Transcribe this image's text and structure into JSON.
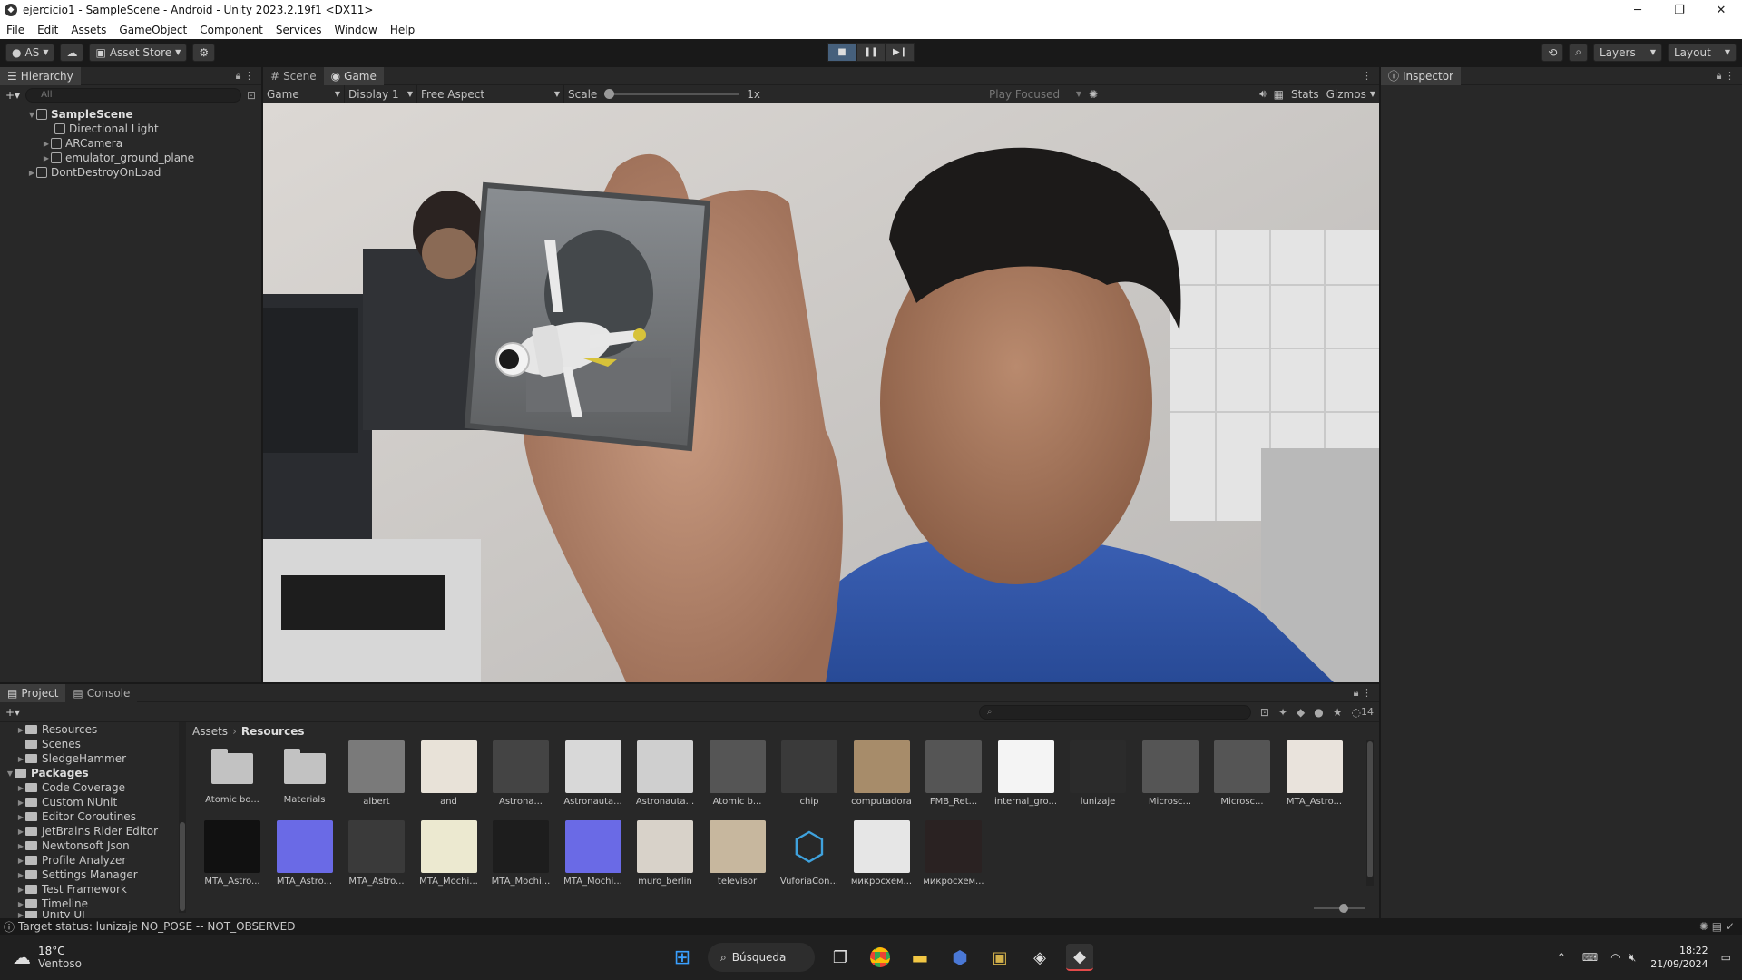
{
  "window": {
    "title": "ejercicio1 - SampleScene - Android - Unity 2023.2.19f1 <DX11>"
  },
  "menu": [
    "File",
    "Edit",
    "Assets",
    "GameObject",
    "Component",
    "Services",
    "Window",
    "Help"
  ],
  "toolbar": {
    "account": "AS",
    "asset_store": "Asset Store",
    "layers": "Layers",
    "layout": "Layout"
  },
  "hierarchy": {
    "tab": "Hierarchy",
    "search_placeholder": "All",
    "items": [
      {
        "label": "SampleScene",
        "indent": 0,
        "bold": true
      },
      {
        "label": "Directional Light",
        "indent": 2,
        "bold": false
      },
      {
        "label": "ARCamera",
        "indent": 1,
        "bold": false
      },
      {
        "label": "emulator_ground_plane",
        "indent": 1,
        "bold": false
      },
      {
        "label": "DontDestroyOnLoad",
        "indent": 0,
        "bold": false
      }
    ]
  },
  "game": {
    "tabs": [
      "Scene",
      "Game"
    ],
    "mode": "Game",
    "display": "Display 1",
    "aspect": "Free Aspect",
    "scale_label": "Scale",
    "scale_value": "1x",
    "play_focused": "Play Focused",
    "stats": "Stats",
    "gizmos": "Gizmos"
  },
  "inspector": {
    "tab": "Inspector"
  },
  "project": {
    "tabs": [
      "Project",
      "Console"
    ],
    "breadcrumb": [
      "Assets",
      "Resources"
    ],
    "hidden_count": "14",
    "tree": [
      {
        "label": "Resources",
        "indent": 1,
        "bold": false
      },
      {
        "label": "Scenes",
        "indent": 1,
        "bold": false
      },
      {
        "label": "SledgeHammer",
        "indent": 1,
        "bold": false
      },
      {
        "label": "Packages",
        "indent": 0,
        "bold": true
      },
      {
        "label": "Code Coverage",
        "indent": 1,
        "bold": false
      },
      {
        "label": "Custom NUnit",
        "indent": 1,
        "bold": false
      },
      {
        "label": "Editor Coroutines",
        "indent": 1,
        "bold": false
      },
      {
        "label": "JetBrains Rider Editor",
        "indent": 1,
        "bold": false
      },
      {
        "label": "Newtonsoft Json",
        "indent": 1,
        "bold": false
      },
      {
        "label": "Profile Analyzer",
        "indent": 1,
        "bold": false
      },
      {
        "label": "Settings Manager",
        "indent": 1,
        "bold": false
      },
      {
        "label": "Test Framework",
        "indent": 1,
        "bold": false
      },
      {
        "label": "Timeline",
        "indent": 1,
        "bold": false
      },
      {
        "label": "Unity UI",
        "indent": 1,
        "bold": false
      }
    ],
    "assets_row1": [
      "Atomic bo...",
      "Materials",
      "albert",
      "and",
      "Astrona...",
      "Astronauta...",
      "Astronauta...",
      "Atomic b...",
      "chip",
      "computadora",
      "FMB_Ret...",
      "internal_gro...",
      "lunizaje",
      "Microsc...",
      "Microsc...",
      "MTA_Astro..."
    ],
    "assets_row2": [
      "MTA_Astro...",
      "MTA_Astro...",
      "MTA_Astro...",
      "MTA_Mochi...",
      "MTA_Mochi...",
      "MTA_Mochi...",
      "muro_berlin",
      "televisor",
      "VuforiaCon...",
      "микросхем...",
      "микросхем..."
    ]
  },
  "status": {
    "message": "Target status: lunizaje NO_POSE -- NOT_OBSERVED"
  },
  "taskbar": {
    "temperature": "18°C",
    "weather": "Ventoso",
    "search": "Búsqueda",
    "time": "18:22",
    "date": "21/09/2024"
  }
}
